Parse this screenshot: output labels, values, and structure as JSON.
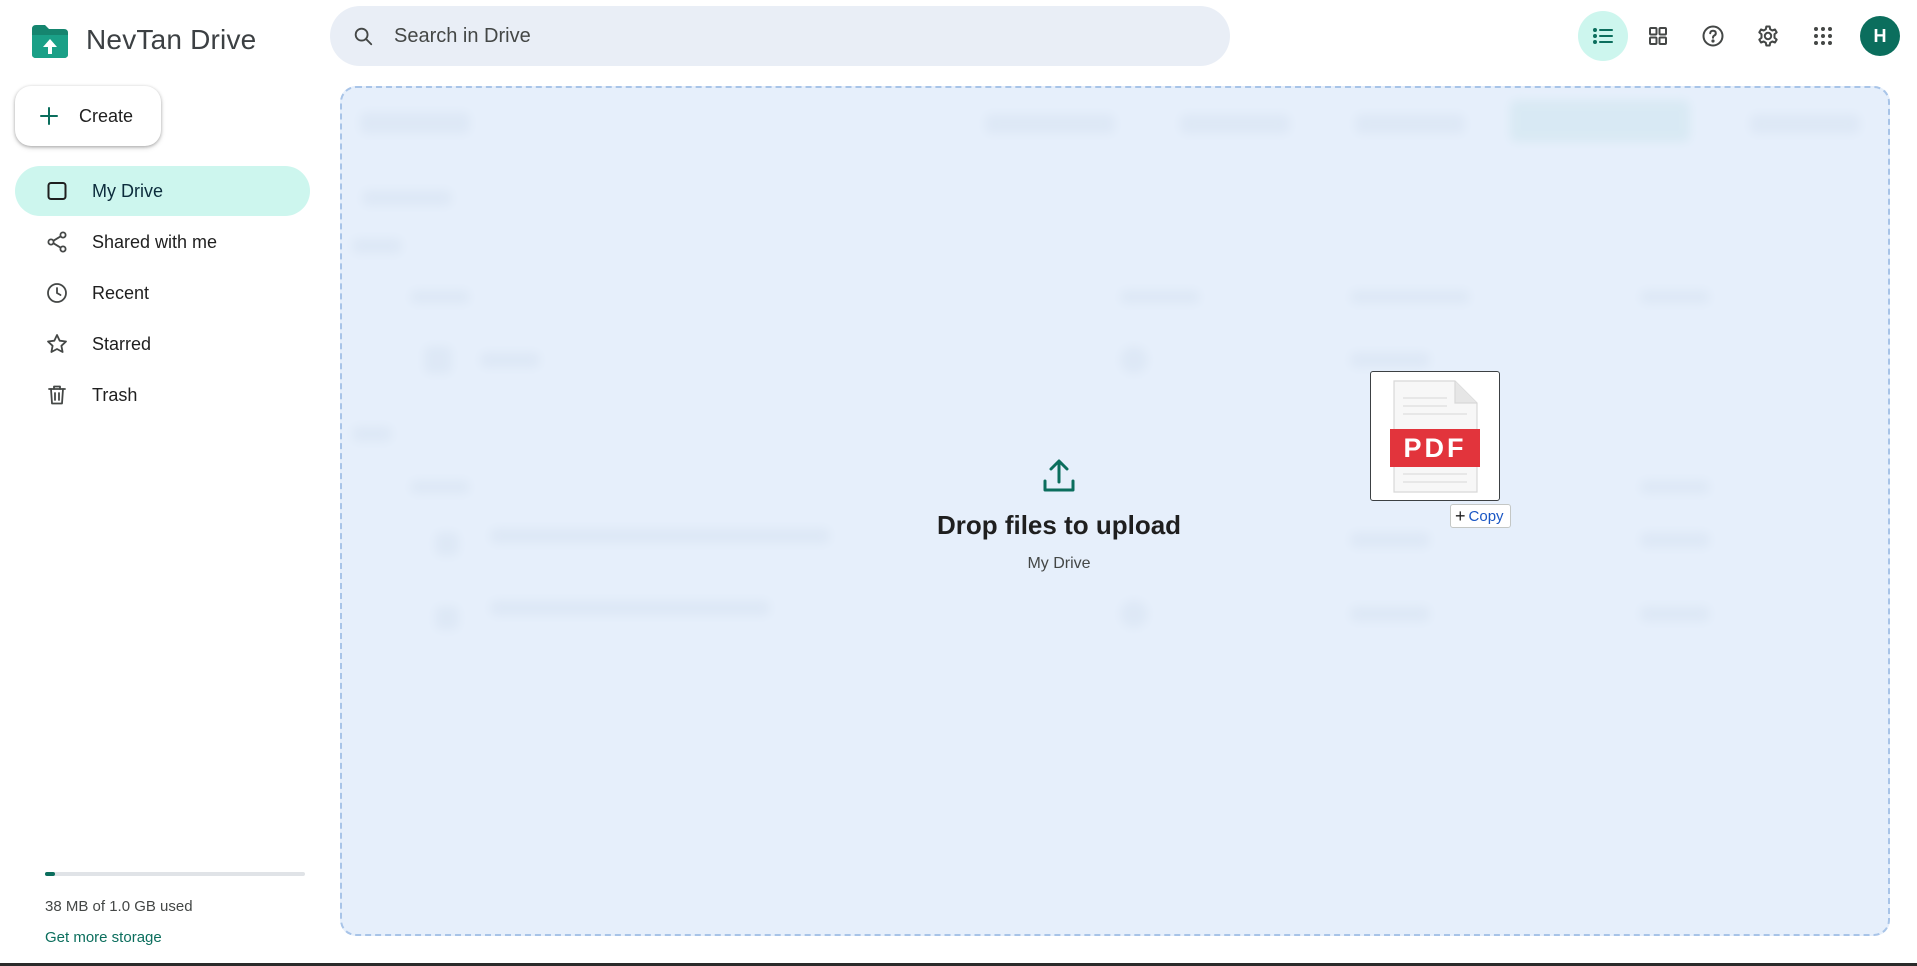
{
  "app": {
    "name": "NevTan Drive"
  },
  "search": {
    "placeholder": "Search in Drive"
  },
  "top_actions": {
    "avatar_initial": "H"
  },
  "create": {
    "label": "Create"
  },
  "sidebar": {
    "items": [
      {
        "label": "My Drive",
        "icon": "drive-icon",
        "active": true
      },
      {
        "label": "Shared with me",
        "icon": "share-icon",
        "active": false
      },
      {
        "label": "Recent",
        "icon": "clock-icon",
        "active": false
      },
      {
        "label": "Starred",
        "icon": "star-icon",
        "active": false
      },
      {
        "label": "Trash",
        "icon": "trash-icon",
        "active": false
      }
    ]
  },
  "storage": {
    "used_fraction": 0.038,
    "text": "38 MB of 1.0 GB used",
    "link": "Get more storage"
  },
  "dropzone": {
    "title": "Drop files to upload",
    "subtitle": "My Drive"
  },
  "drag": {
    "file_type_label": "PDF",
    "action_label": "Copy"
  },
  "colors": {
    "accent": "#0b6e5d",
    "active_bg": "#cdf6ee",
    "search_bg": "#e9eef6",
    "dropzone_bg": "#dfeafa",
    "pdf_red": "#e2343c"
  }
}
